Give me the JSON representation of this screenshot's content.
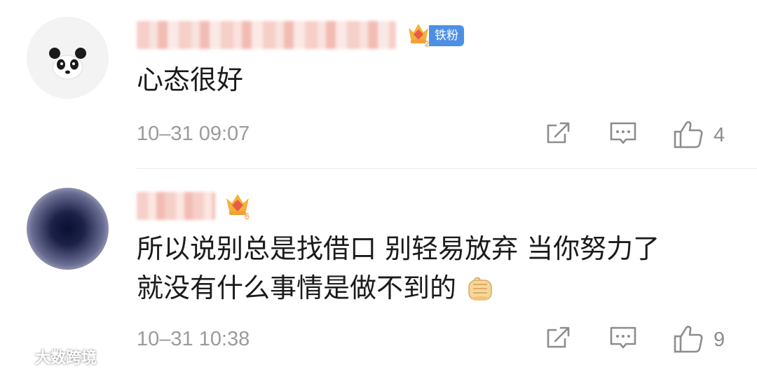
{
  "comments": [
    {
      "content": "心态很好",
      "fan_badge": "铁粉",
      "crown_level": "2",
      "timestamp": "10–31 09:07",
      "likes": "4"
    },
    {
      "content_line1": "所以说别总是找借口 别轻易放弃 当你努力了",
      "content_line2": "就没有什么事情是做不到的",
      "crown_level": "6",
      "timestamp": "10–31 10:38",
      "likes": "9"
    }
  ],
  "icons": {
    "avatar1": "panda-avatar-icon",
    "crown": "crown-level-icon",
    "share": "share-icon",
    "reply": "comment-icon",
    "like": "thumbs-up-icon",
    "emoji": "fist-emoji-icon"
  },
  "watermark": "大数跨境",
  "colors": {
    "badge_blue": "#4e8fe6",
    "timestamp_gray": "#9b9b9b",
    "icon_gray": "#8c8c8c"
  }
}
